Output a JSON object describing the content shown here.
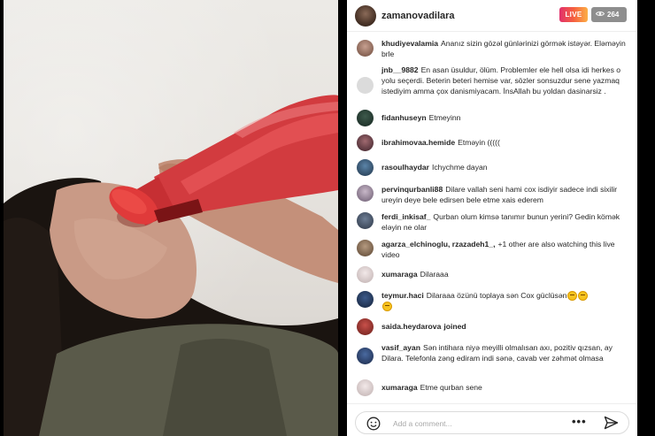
{
  "header": {
    "username": "zamanovadilara",
    "live_label": "LIVE",
    "viewer_count": "264"
  },
  "comments": [
    {
      "user": "khudiyevalamia",
      "text": "Ananız sizin gözəl günlərinizi görmək istəyər. Eləməyin brle"
    },
    {
      "user": "jnb__9882",
      "text": "En asan üsuldur, ölüm. Problemler ele hell olsa idi herkes o yolu seçerdi. Beterin beteri hemise var, sözler sonsuzdur sene yazmaq istediyim amma çox danismiyacam. İnsAllah bu yoldan dasinarsiz ."
    },
    {
      "user": "fidanhuseyn",
      "text": "Etmeyinn"
    },
    {
      "user": "ibrahimovaa.hemide",
      "text": "Etməyin ((((("
    },
    {
      "user": "rasoulhaydar",
      "text": "Ichychme dayan"
    },
    {
      "user": "pervinqurbanli88",
      "text": "Dilare vallah seni hami cox isdiyir sadece indi sixilir ureyin deye bele edirsen bele etme xais ederem"
    },
    {
      "user": "ferdi_inkisaf_",
      "text": "Qurban olum kimsə tanımır bunun yerini? Gedin kömək eləyin ne olar"
    },
    {
      "user": "agarza_elchinoglu, rzazadeh1_,",
      "text": "+1 other are also watching this live video"
    },
    {
      "user": "xumaraga",
      "text": "Dilaraaa"
    },
    {
      "user": "teymur.haci",
      "text": "Dilaraaa özünü toplaya sən Cox güclüsən"
    },
    {
      "user": "saida.heydarova",
      "text": "joined"
    },
    {
      "user": "vasif_ayan",
      "text": "Sən intihara niyə meyilli olmalısan axı, pozitiv qızsan, ay Dilara. Telefonla zəng ediram indi sənə, cavab ver zəhmət olmasa"
    },
    {
      "user": "xumaraga",
      "text": "Etme qurban sene"
    }
  ],
  "footer": {
    "comment_placeholder": "Add a comment..."
  },
  "icons": {
    "viewers": "eye-icon",
    "emoji": "smile-icon",
    "more": "more-icon",
    "send": "send-icon"
  },
  "colors": {
    "live_gradient": [
      "#e1306c",
      "#f56040",
      "#fcaf45"
    ],
    "viewer_badge": "#8e8e8e",
    "text": "#262626"
  }
}
